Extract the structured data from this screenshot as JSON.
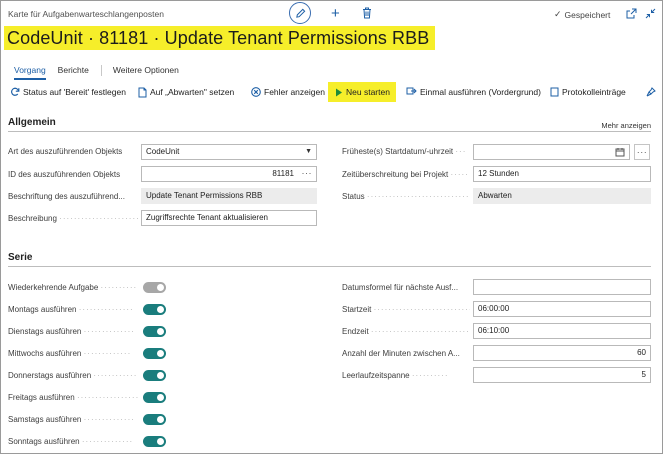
{
  "page": {
    "caption": "Karte für Aufgabenwarteschlangenposten",
    "title": "CodeUnit · 81181 · Update Tenant Permissions RBB",
    "saved_label": "Gespeichert"
  },
  "tabs": [
    "Vorgang",
    "Berichte",
    "Weitere Optionen"
  ],
  "toolbar": {
    "set_ready": "Status auf 'Bereit' festlegen",
    "set_on_hold": "Auf „Abwarten\" setzen",
    "show_error": "Fehler anzeigen",
    "restart": "Neu starten",
    "run_once": "Einmal ausführen (Vordergrund)",
    "log_entries": "Protokolleinträge"
  },
  "general": {
    "heading": "Allgemein",
    "more_link": "Mehr anzeigen",
    "object_type_label": "Art des auszuführenden Objekts",
    "object_type_value": "CodeUnit",
    "object_id_label": "ID des auszuführenden Objekts",
    "object_id_value": "81181",
    "object_caption_label": "Beschriftung des auszuführend...",
    "object_caption_value": "Update Tenant Permissions RBB",
    "description_label": "Beschreibung",
    "description_value": "Zugriffsrechte Tenant aktualisieren",
    "earliest_start_label": "Früheste(s) Startdatum/-uhrzeit",
    "earliest_start_value": "",
    "timeout_label": "Zeitüberschreitung bei Projekt",
    "timeout_value": "12 Stunden",
    "status_label": "Status",
    "status_value": "Abwarten"
  },
  "series": {
    "heading": "Serie",
    "recurring_label": "Wiederkehrende Aufgabe",
    "recurring": false,
    "days": [
      {
        "label": "Montags ausführen",
        "on": true
      },
      {
        "label": "Dienstags ausführen",
        "on": true
      },
      {
        "label": "Mittwochs ausführen",
        "on": true
      },
      {
        "label": "Donnerstags ausführen",
        "on": true
      },
      {
        "label": "Freitags ausführen",
        "on": true
      },
      {
        "label": "Samstags ausführen",
        "on": true
      },
      {
        "label": "Sonntags ausführen",
        "on": true
      }
    ],
    "next_date_formula_label": "Datumsformel für nächste Ausf...",
    "next_date_formula_value": "",
    "start_time_label": "Startzeit",
    "start_time_value": "06:00:00",
    "end_time_label": "Endzeit",
    "end_time_value": "06:10:00",
    "minutes_between_label": "Anzahl der Minuten zwischen A...",
    "minutes_between_value": "60",
    "inactivity_label": "Leerlaufzeitspanne",
    "inactivity_value": "5"
  },
  "colors": {
    "highlight": "#f6ee2a",
    "accent": "#1d5fa6",
    "toggle_on": "#1a7d7d",
    "toggle_off": "#a7a7a7"
  }
}
